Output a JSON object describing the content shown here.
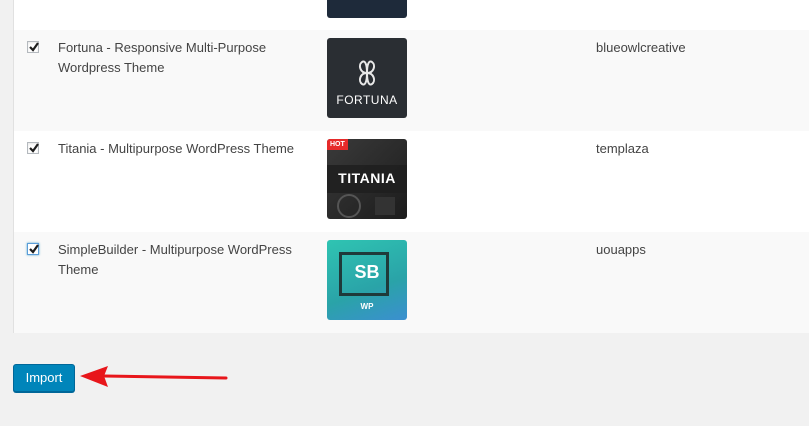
{
  "themes": [
    {
      "title": "Fortuna - Responsive Multi-Purpose Wordpress Theme",
      "author": "blueowlcreative",
      "thumb_text": "FORTUNA",
      "checked": true
    },
    {
      "title": "Titania - Multipurpose WordPress Theme",
      "author": "templaza",
      "thumb_text": "TITANIA",
      "badge": "HOT",
      "checked": true
    },
    {
      "title": "SimpleBuilder - Multipurpose WordPress Theme",
      "author": "uouapps",
      "thumb_text": "SB",
      "thumb_sub": "WP",
      "checked": true
    }
  ],
  "actions": {
    "import_label": "Import"
  },
  "colors": {
    "primary": "#0085ba",
    "arrow": "#e8161b",
    "fortuna_bg": "#2a2e33",
    "sb_bg": "#2fc4b2"
  }
}
